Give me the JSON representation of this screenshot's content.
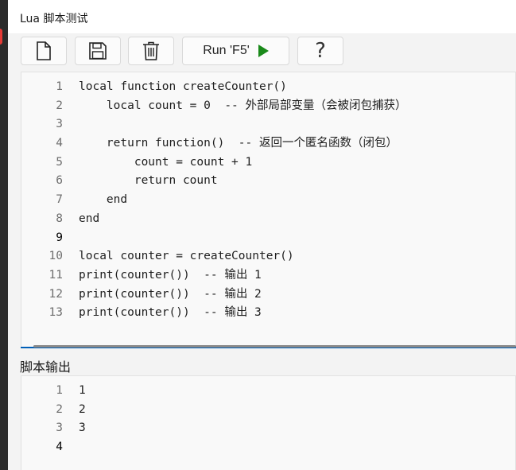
{
  "window": {
    "title": "Lua 脚本测试"
  },
  "toolbar": {
    "new_icon": "new-file-icon",
    "save_icon": "save-icon",
    "delete_icon": "trash-icon",
    "run_label": "Run 'F5'",
    "run_icon": "play-icon",
    "help_label": "?"
  },
  "editor": {
    "current_line": 9,
    "lines": [
      {
        "n": "1",
        "text": "local function createCounter()"
      },
      {
        "n": "2",
        "text": "    local count = 0  -- 外部局部变量（会被闭包捕获）"
      },
      {
        "n": "3",
        "text": ""
      },
      {
        "n": "4",
        "text": "    return function()  -- 返回一个匿名函数（闭包）"
      },
      {
        "n": "5",
        "text": "        count = count + 1"
      },
      {
        "n": "6",
        "text": "        return count"
      },
      {
        "n": "7",
        "text": "    end"
      },
      {
        "n": "8",
        "text": "end"
      },
      {
        "n": "9",
        "text": ""
      },
      {
        "n": "10",
        "text": "local counter = createCounter()"
      },
      {
        "n": "11",
        "text": "print(counter())  -- 输出 1"
      },
      {
        "n": "12",
        "text": "print(counter())  -- 输出 2"
      },
      {
        "n": "13",
        "text": "print(counter())  -- 输出 3"
      }
    ]
  },
  "output": {
    "label": "脚本输出",
    "current_line": 4,
    "lines": [
      {
        "n": "1",
        "text": "1"
      },
      {
        "n": "2",
        "text": "2"
      },
      {
        "n": "3",
        "text": "3"
      },
      {
        "n": "4",
        "text": ""
      }
    ]
  },
  "colors": {
    "accent": "#005fb8",
    "run_green": "#1a8a1a"
  }
}
